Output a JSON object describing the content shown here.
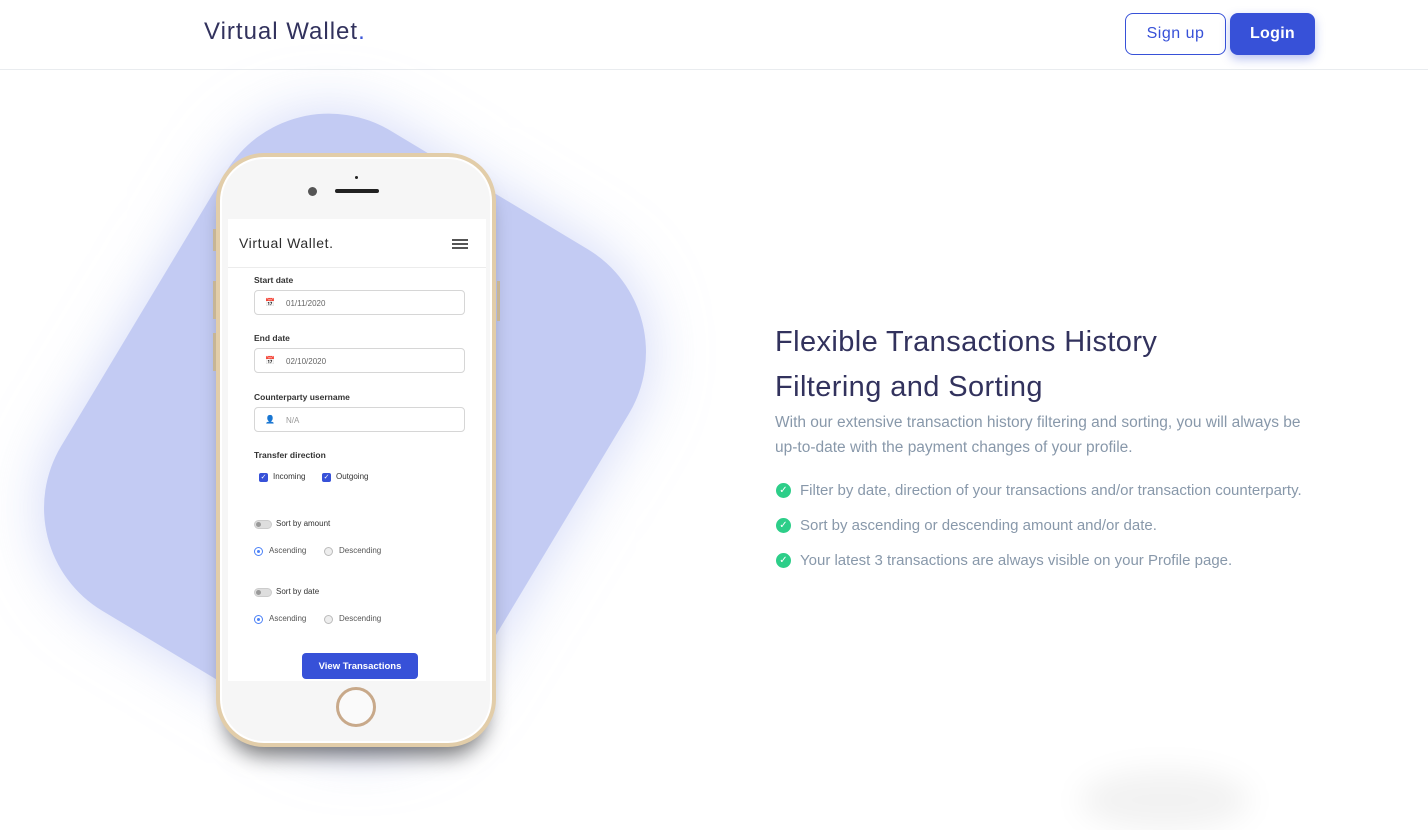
{
  "header": {
    "brand": "Virtual Wallet",
    "brand_dot": ".",
    "signup_label": "Sign up",
    "login_label": "Login"
  },
  "phone": {
    "brand": "Virtual Wallet.",
    "start_date_label": "Start date",
    "start_date_value": "01/11/2020",
    "end_date_label": "End date",
    "end_date_value": "02/10/2020",
    "counterparty_label": "Counterparty username",
    "counterparty_placeholder": "N/A",
    "direction_label": "Transfer direction",
    "incoming_label": "Incoming",
    "outgoing_label": "Outgoing",
    "sort_amount_label": "Sort by amount",
    "sort_date_label": "Sort by date",
    "ascending_label": "Ascending",
    "descending_label": "Descending",
    "view_button": "View Transactions"
  },
  "feature": {
    "title_line1": "Flexible Transactions History",
    "title_line2": "Filtering and Sorting",
    "description": "With our extensive transaction history filtering and sorting, you will always be up-to-date with the payment changes of your profile.",
    "items": [
      "Filter by date, direction of your transactions and/or transaction counterparty.",
      "Sort by ascending or descending amount and/or date.",
      "Your latest 3 transactions are always visible on your Profile page."
    ]
  },
  "colors": {
    "accent": "#3751d8",
    "blob": "#c3cbf3",
    "check": "#2dce89",
    "muted_text": "#8898aa"
  }
}
